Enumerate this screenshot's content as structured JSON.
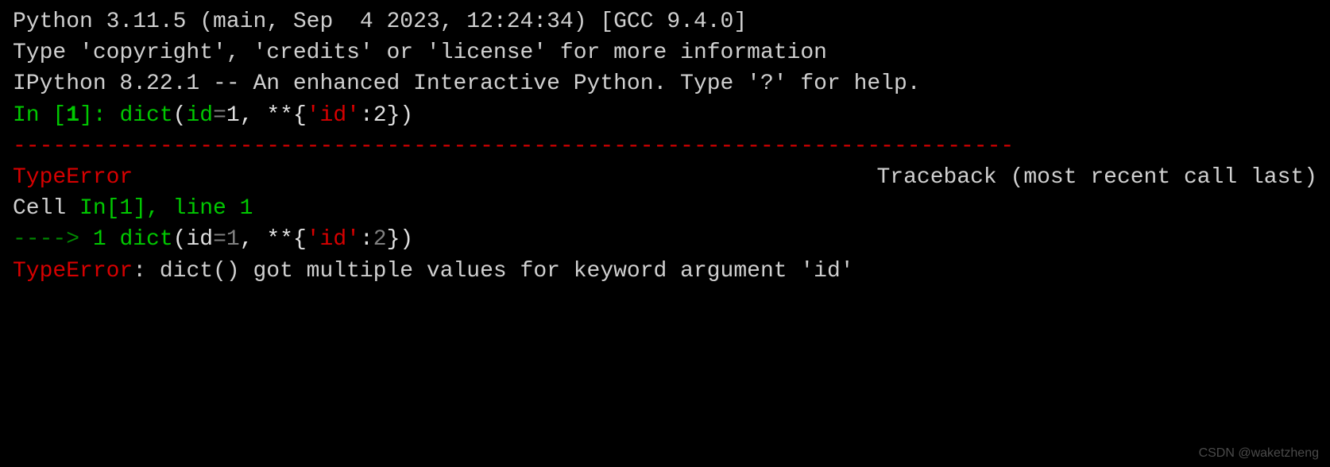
{
  "header": {
    "python_version": "Python 3.11.5 (main, Sep  4 2023, 12:24:34) [GCC 9.4.0]",
    "copyright_line": "Type 'copyright', 'credits' or 'license' for more information",
    "ipython_line": "IPython 8.22.1 -- An enhanced Interactive Python. Type '?' for help."
  },
  "blank": "",
  "prompt": {
    "in_label": "In [",
    "in_num": "1",
    "in_close": "]: ",
    "code": {
      "func": "dict",
      "paren_open": "(",
      "kw": "id",
      "eq": "=",
      "val1": "1",
      "comma": ", ",
      "unpack": "**",
      "brace_open": "{",
      "str_key": "'id'",
      "colon": ":",
      "val2": "2",
      "brace_close": "}",
      "paren_close": ")"
    }
  },
  "traceback": {
    "separator": "---------------------------------------------------------------------------",
    "error_name": "TypeError",
    "traceback_label": "Traceback (most recent call last)",
    "cell_prefix": "Cell ",
    "cell_ref": "In[1]",
    "cell_suffix": ", line 1",
    "arrow": "----> ",
    "lineno": "1",
    "space": " ",
    "code": {
      "func": "dict",
      "paren_open": "(",
      "kw": "id",
      "eq": "=",
      "val1": "1",
      "comma": ", ",
      "unpack": "**",
      "brace_open": "{",
      "str_key": "'id'",
      "colon": ":",
      "val2": "2",
      "brace_close": "}",
      "paren_close": ")"
    }
  },
  "error": {
    "name": "TypeError",
    "message": ": dict() got multiple values for keyword argument 'id'"
  },
  "watermark": "CSDN @waketzheng"
}
